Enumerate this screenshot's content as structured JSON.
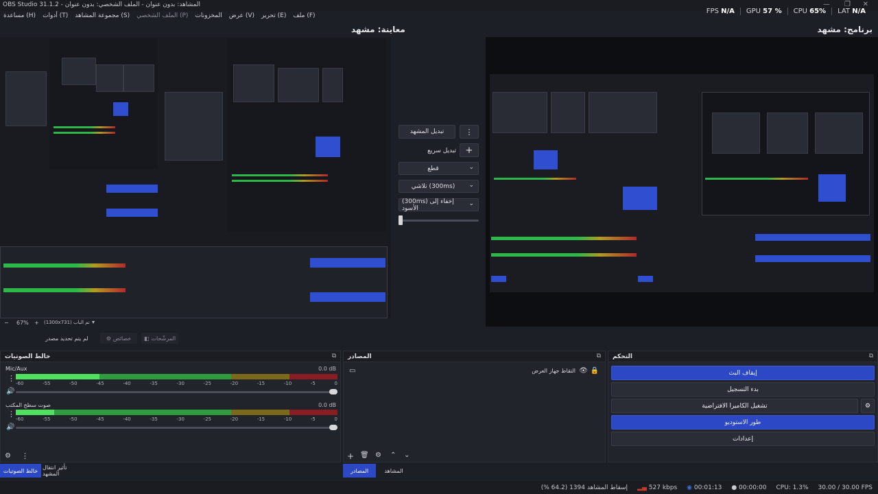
{
  "window": {
    "title": "OBS Studio 31.1.2 - المشاهد: بدون عنوان - الملف الشخصي: بدون عنوان",
    "controls": [
      "—",
      "❐",
      "✕"
    ]
  },
  "menu": [
    {
      "label": "ملف (F)",
      "dim": false
    },
    {
      "label": "تحرير (E)",
      "dim": false
    },
    {
      "label": "عرض (V)",
      "dim": false
    },
    {
      "label": "المخزونات",
      "dim": false
    },
    {
      "label": "الملف الشخصي (P)",
      "dim": true
    },
    {
      "label": "مجموعة المشاهد (S)",
      "dim": false
    },
    {
      "label": "أدوات (T)",
      "dim": false
    },
    {
      "label": "مساعدة (H)",
      "dim": false
    }
  ],
  "stats": [
    {
      "label": "FPS",
      "value": "N/A"
    },
    {
      "label": "GPU",
      "value": "57 %"
    },
    {
      "label": "CPU",
      "value": "65%"
    },
    {
      "label": "LAT",
      "value": "N/A"
    }
  ],
  "preview_label": "معاينة: مشهد",
  "program_label": "برنامج: مشهد",
  "transitions": {
    "scene_button": "تبديل المشهد",
    "quick_label": "تبديل سريع",
    "options": [
      "قطع",
      "تلاشي (300ms)",
      "(300ms) إخفاء إلى الأسود"
    ]
  },
  "zoom": {
    "percent": "67%",
    "fit": "(1300x731) تم الباب"
  },
  "context": {
    "no_source": "لم يتم تحديد مصدر",
    "properties": "خصائص",
    "filters": "المرشّحات"
  },
  "mixer": {
    "title": "خالط الصوتيات",
    "channels": [
      {
        "name": "Mic/Aux",
        "db": "0.0 dB",
        "level": 0.26
      },
      {
        "name": "صوت سطح المكتب",
        "db": "0.0 dB",
        "level": 0.12
      }
    ],
    "ticks": [
      "-60",
      "-55",
      "-50",
      "-45",
      "-40",
      "-35",
      "-30",
      "-25",
      "-20",
      "-15",
      "-10",
      "-5",
      "0"
    ]
  },
  "sources": {
    "title": "المصادر",
    "items": [
      {
        "name": "التقاط جهاز العرض"
      }
    ]
  },
  "controls": {
    "title": "التحكم",
    "buttons": [
      {
        "label": "إيقاف البث",
        "style": "blue"
      },
      {
        "label": "بدء التسجيل",
        "style": "gray"
      },
      {
        "label": "تشغيل الكاميرا الافتراضية",
        "style": "gray"
      },
      {
        "label": "طور الاستوديو",
        "style": "blue"
      },
      {
        "label": "إعدادات",
        "style": "gray"
      }
    ]
  },
  "bottom_tabs": {
    "left": [
      "خالط الصوتيات",
      "تأثير انتقال المشهد"
    ],
    "mid": [
      "المصادر",
      "المشاهد"
    ]
  },
  "status": {
    "dropped": "إسقاط المشاهد 1394 (64.2 %)",
    "bitrate": "527 kbps",
    "stream_time": "00:01:13",
    "rec_time": "00:00:00",
    "cpu": "CPU: 1.3%",
    "fps": "30.00 / 30.00 FPS"
  },
  "colors": {
    "accent": "#2c48c4",
    "bg": "#1d1f26",
    "panel": "#22242c"
  }
}
